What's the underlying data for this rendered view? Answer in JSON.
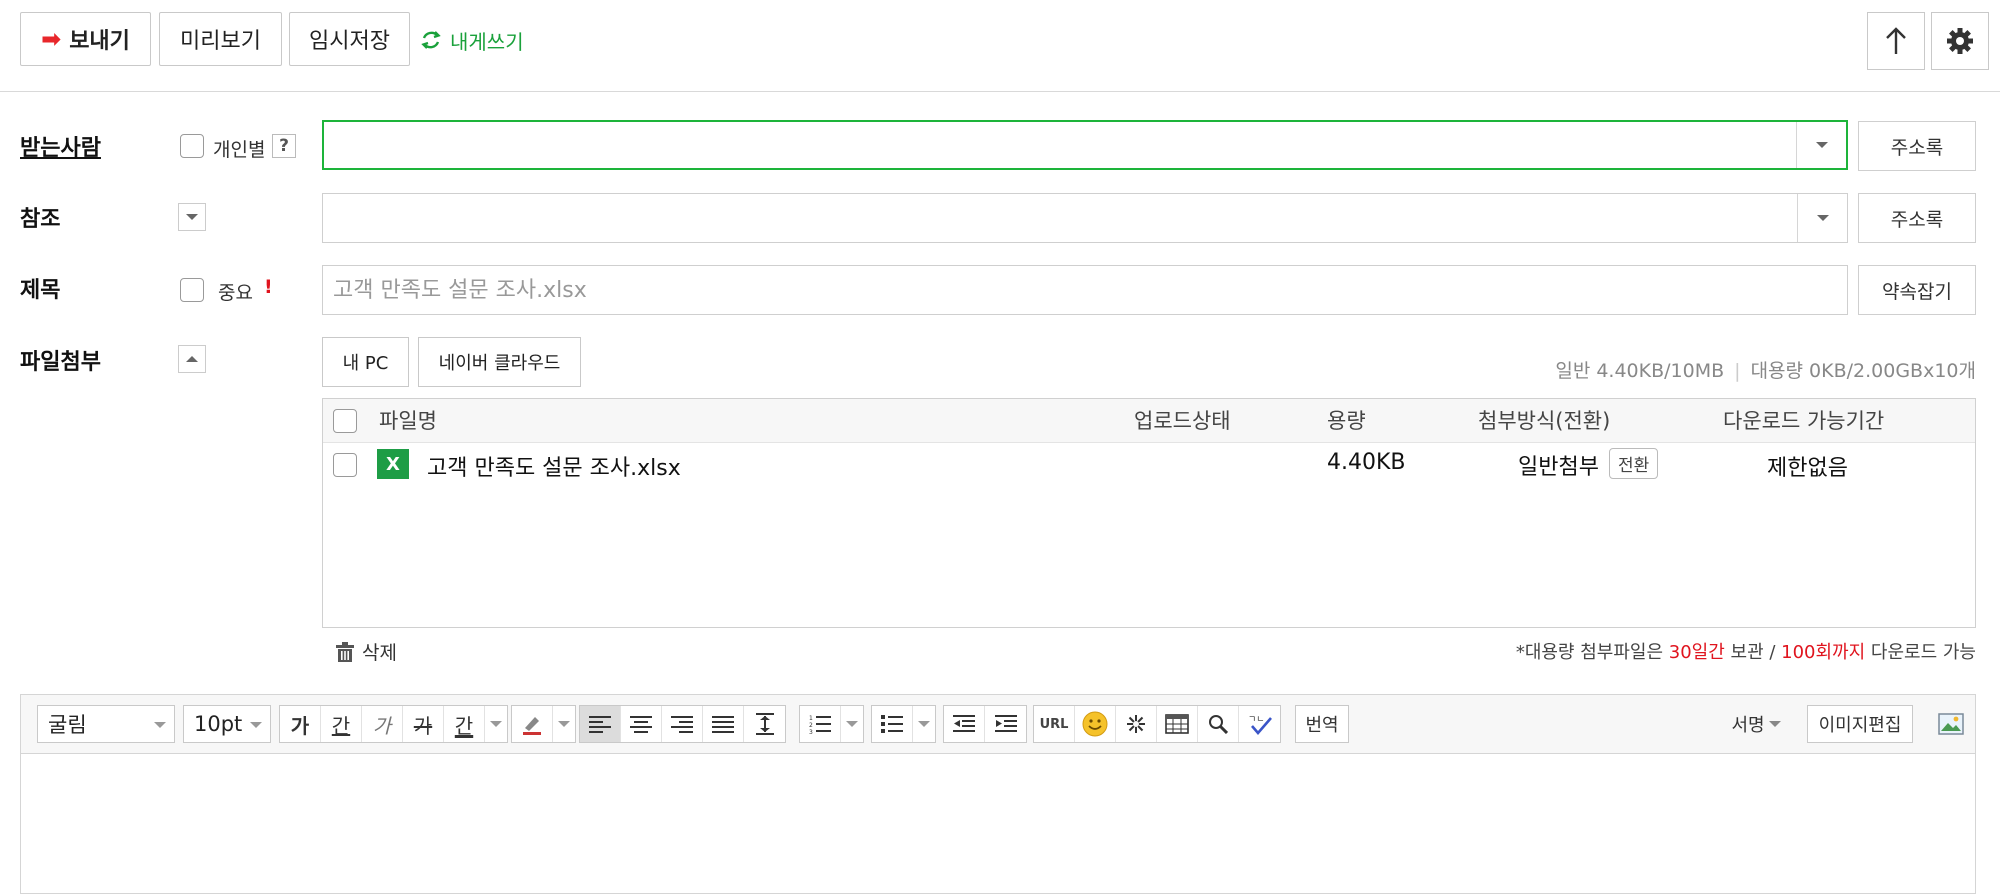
{
  "toolbar": {
    "send_label": "보내기",
    "preview_label": "미리보기",
    "draft_label": "임시저장",
    "to_me_label": "내게쓰기"
  },
  "recipient": {
    "label": "받는사람",
    "individual_label": "개인별",
    "help_label": "?",
    "value": "",
    "address_book_label": "주소록"
  },
  "cc": {
    "label": "참조",
    "value": "",
    "address_book_label": "주소록"
  },
  "subject": {
    "label": "제목",
    "important_label": "중요",
    "important_mark": "!",
    "placeholder": "고객 만족도 설문 조사.xlsx",
    "appointment_label": "약속잡기"
  },
  "attachment": {
    "label": "파일첨부",
    "my_pc_label": "내 PC",
    "cloud_label": "네이버 클라우드",
    "quota_general": "일반 4.40KB/10MB",
    "quota_large": "대용량 0KB/2.00GBx10개",
    "columns": [
      "파일명",
      "업로드상태",
      "용량",
      "첨부방식(전환)",
      "다운로드 가능기간"
    ],
    "files": [
      {
        "name": "고객 만족도 설문 조사.xlsx",
        "icon": "excel-icon",
        "icon_glyph": "X",
        "status": "",
        "size": "4.40KB",
        "method": "일반첨부",
        "convert_label": "전환",
        "period": "제한없음"
      }
    ],
    "delete_label": "삭제",
    "notice_prefix": "*대용량 첨부파일은 ",
    "notice_days": "30일간",
    "notice_mid": " 보관 / ",
    "notice_count": "100회까지",
    "notice_suffix": " 다운로드 가능"
  },
  "editor": {
    "font_family": "굴림",
    "font_size": "10pt",
    "bold_glyph": "가",
    "underline_glyph": "간",
    "italic_glyph": "가",
    "strike_glyph": "가",
    "color_glyph": "간",
    "url_label": "URL",
    "translate_label": "번역",
    "signature_label": "서명",
    "image_edit_label": "이미지편집"
  },
  "colors": {
    "accent_green": "#1db43a",
    "send_arrow": "#e8272b",
    "notice_red": "#e0141e",
    "excel_green": "#1e9d46"
  }
}
